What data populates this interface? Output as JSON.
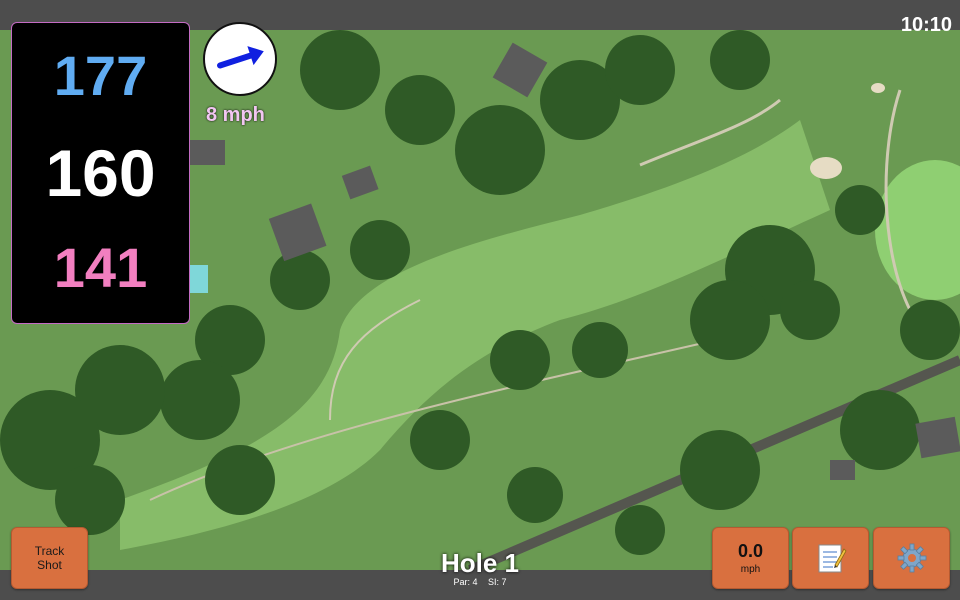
{
  "status": {
    "time": "10:10"
  },
  "distances": {
    "back": "177",
    "center": "160",
    "front": "141"
  },
  "wind": {
    "direction_icon": "arrow-right-icon",
    "speed_label": "8 mph"
  },
  "buttons": {
    "track_shot_line1": "Track",
    "track_shot_line2": "Shot",
    "wind_value": "0.0",
    "wind_unit": "mph",
    "notes_icon": "notepad-icon",
    "settings_icon": "gear-icon"
  },
  "hole": {
    "title": "Hole 1",
    "par": "Par: 4",
    "si": "SI: 7"
  },
  "colors": {
    "accent_orange": "#d9703f",
    "back_blue": "#60acf2",
    "front_pink": "#f27fc0"
  }
}
